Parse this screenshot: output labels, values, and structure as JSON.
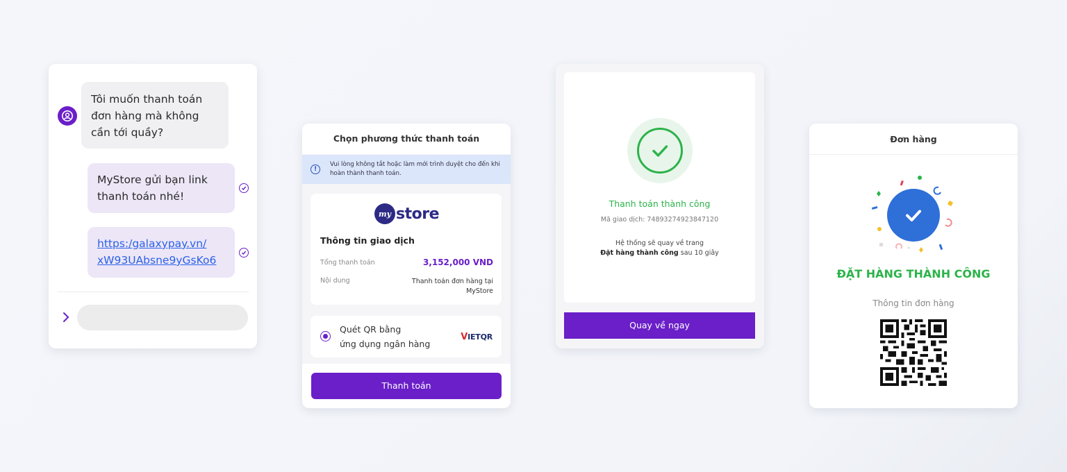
{
  "chat": {
    "user_message": "Tôi muốn thanh toán đơn hàng mà không cần tới quầy?",
    "bot_message": "MyStore gửi bạn link thanh toán nhé!",
    "link_text": "https:/galaxypay.vn/ xW93UAbsne9yGsKo6",
    "icons": [
      "user-avatar-icon",
      "check-circle-icon",
      "chevron-right-icon"
    ]
  },
  "payment": {
    "header": "Chọn phương thức thanh toán",
    "notice": "Vui lòng không tắt hoặc làm mới trình duyệt cho đến khi hoàn thành thanh toán.",
    "logo_text": "store",
    "logo_mark": "my",
    "section_title": "Thông tin giao dịch",
    "total_label": "Tổng thanh toán",
    "total_value": "3,152,000 VND",
    "content_label": "Nội dung",
    "content_value": "Thanh toán đơn hàng tại MyStore",
    "qr_option_line1": "Quét QR bằng",
    "qr_option_line2": "ứng dụng ngân hàng",
    "vietqr_v": "V",
    "vietqr_rest": "IETQR",
    "pay_button": "Thanh toán"
  },
  "success": {
    "title": "Thanh toán thành công",
    "transaction_code": "Mã giao dịch: 74893274923847120",
    "note_line1": "Hệ thống sẽ quay về trang",
    "note_bold": "Đặt hàng thành công",
    "note_suffix": " sau 10 giây",
    "back_button": "Quay về ngay"
  },
  "order": {
    "header": "Đơn hàng",
    "title": "ĐẶT HÀNG THÀNH CÔNG",
    "info_label": "Thông tin đơn hàng"
  },
  "colors": {
    "primary": "#6a1fc8",
    "success": "#2cb34a",
    "badge_blue": "#2f6fd8",
    "link": "#2a62e8",
    "bot_bubble": "#ede6f7"
  }
}
